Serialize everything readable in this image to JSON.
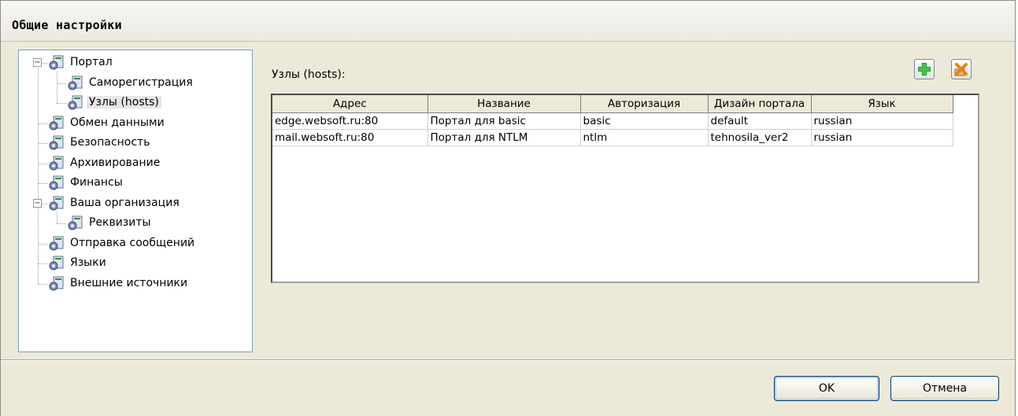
{
  "window": {
    "title": "Общие настройки"
  },
  "tree": {
    "items": [
      {
        "label": "Портал",
        "level": 0,
        "expander": "−"
      },
      {
        "label": "Саморегистрация",
        "level": 1
      },
      {
        "label": "Узлы (hosts)",
        "level": 1,
        "selected": true
      },
      {
        "label": "Обмен данными",
        "level": 0
      },
      {
        "label": "Безопасность",
        "level": 0
      },
      {
        "label": "Архивирование",
        "level": 0
      },
      {
        "label": "Финансы",
        "level": 0
      },
      {
        "label": "Ваша организация",
        "level": 0,
        "expander": "−"
      },
      {
        "label": "Реквизиты",
        "level": 1
      },
      {
        "label": "Отправка сообщений",
        "level": 0
      },
      {
        "label": "Языки",
        "level": 0
      },
      {
        "label": "Внешние источники",
        "level": 0
      }
    ]
  },
  "content": {
    "label": "Узлы (hosts):",
    "add_icon": "add-icon",
    "delete_icon": "delete-icon"
  },
  "grid": {
    "columns": [
      "Адрес",
      "Название",
      "Авторизация",
      "Дизайн портала",
      "Язык"
    ],
    "rows": [
      [
        "edge.websoft.ru:80",
        "Портал для basic",
        "basic",
        "default",
        "russian"
      ],
      [
        "mail.websoft.ru:80",
        "Портал для NTLM",
        "ntlm",
        "tehnosila_ver2",
        "russian"
      ]
    ]
  },
  "buttons": {
    "ok": "OK",
    "cancel": "Отмена"
  },
  "colors": {
    "dialog_bg": "#ece9d8",
    "tree_border": "#7f9db9",
    "add_green": "#1e9a2a",
    "delete_orange": "#e8841c"
  }
}
